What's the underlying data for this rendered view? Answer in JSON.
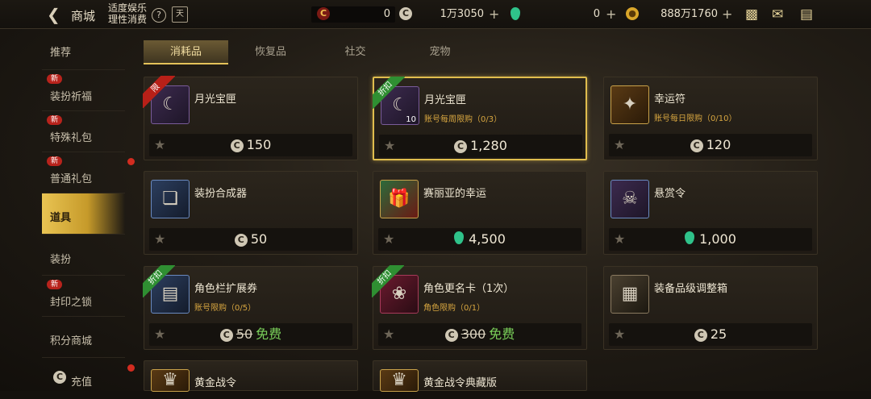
{
  "header": {
    "title": "商城",
    "entertainment": "适度娱乐理性消费",
    "help": "?",
    "calendar": "天",
    "currencies": [
      {
        "icon": "red-coin-icon",
        "value": "0",
        "plus": false
      },
      {
        "icon": "c-coin-icon",
        "value": "1万3050",
        "plus": true
      },
      {
        "icon": "green-gem-icon",
        "value": "0",
        "plus": true
      },
      {
        "icon": "gold-coin-icon",
        "value": "888万1760",
        "plus": true
      }
    ]
  },
  "sidebar": {
    "items": [
      {
        "label": "推荐",
        "new": false
      },
      {
        "label": "装扮祈福",
        "new": true
      },
      {
        "label": "特殊礼包",
        "new": true
      },
      {
        "label": "普通礼包",
        "new": true
      },
      {
        "label": "道具",
        "new": false,
        "active": true
      },
      {
        "label": "装扮",
        "new": false
      },
      {
        "label": "封印之锁",
        "new": true
      },
      {
        "label": "积分商城",
        "new": false
      },
      {
        "label": "充值",
        "new": false
      }
    ],
    "new_label": "新"
  },
  "tabs": [
    {
      "label": "消耗品",
      "active": true
    },
    {
      "label": "恢复品"
    },
    {
      "label": "社交"
    },
    {
      "label": "宠物"
    }
  ],
  "items": [
    {
      "name": "月光宝匣",
      "limit": "",
      "price": "150",
      "currency": "c",
      "ribbon": "限",
      "ribbon_color": "red"
    },
    {
      "name": "月光宝匣",
      "limit": "账号每周限购（0/3）",
      "price": "1,280",
      "currency": "c",
      "ribbon": "折扣",
      "ribbon_color": "green",
      "qty": "10",
      "selected": true
    },
    {
      "name": "幸运符",
      "limit": "账号每日限购（0/10）",
      "price": "120",
      "currency": "c"
    },
    {
      "name": "装扮合成器",
      "limit": "",
      "price": "50",
      "currency": "c"
    },
    {
      "name": "赛丽亚的幸运",
      "limit": "",
      "price": "4,500",
      "currency": "gem"
    },
    {
      "name": "悬赏令",
      "limit": "",
      "price": "1,000",
      "currency": "gem"
    },
    {
      "name": "角色栏扩展券",
      "limit": "账号限购（0/5）",
      "price": "50",
      "currency": "c",
      "free": "免费",
      "ribbon": "折扣",
      "ribbon_color": "green"
    },
    {
      "name": "角色更名卡（1次）",
      "limit": "角色限购（0/1）",
      "price": "300",
      "currency": "c",
      "free": "免费",
      "ribbon": "折扣",
      "ribbon_color": "green"
    },
    {
      "name": "装备品级调整箱",
      "limit": "",
      "price": "25",
      "currency": "c"
    },
    {
      "name": "黄金战令",
      "limit": ""
    },
    {
      "name": "黄金战令典藏版",
      "limit": ""
    }
  ]
}
